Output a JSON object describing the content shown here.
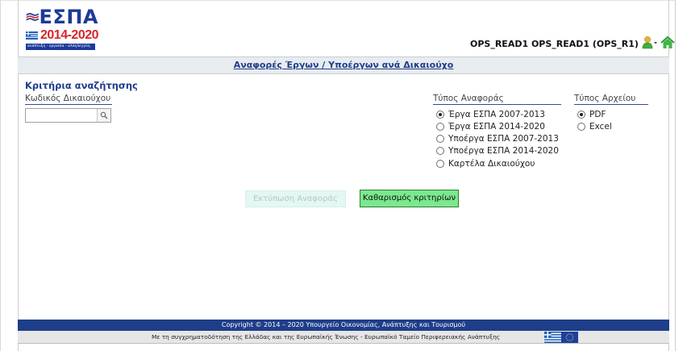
{
  "logo": {
    "brand": "ΕΣΠΑ",
    "years": "2014-2020",
    "slogan": "ανάπτυξη - εργασία - αλληλεγγύη"
  },
  "header": {
    "user": "OPS_READ1 OPS_READ1 (OPS_R1)",
    "user_icon": "user-dropdown-icon",
    "home_icon": "home-icon"
  },
  "title": "Αναφορές Έργων / Υποέργων ανά Δικαιούχο",
  "criteria": {
    "heading": "Κριτήρια αναζήτησης",
    "code_label": "Κωδικός Δικαιούχου",
    "code_value": "",
    "code_placeholder": "",
    "report_type_label": "Τύπος Αναφοράς",
    "report_types": [
      {
        "label": "Έργα ΕΣΠΑ 2007-2013",
        "checked": true
      },
      {
        "label": "Έργα ΕΣΠΑ 2014-2020",
        "checked": false
      },
      {
        "label": "Υποέργα ΕΣΠΑ 2007-2013",
        "checked": false
      },
      {
        "label": "Υποέργα ΕΣΠΑ 2014-2020",
        "checked": false
      },
      {
        "label": "Καρτέλα Δικαιούχου",
        "checked": false
      }
    ],
    "file_type_label": "Τύπος Αρχείου",
    "file_types": [
      {
        "label": "PDF",
        "checked": true
      },
      {
        "label": "Excel",
        "checked": false
      }
    ]
  },
  "buttons": {
    "print": "Εκτύπωση Αναφοράς",
    "clear": "Καθαρισμός κριτηρίων"
  },
  "footer": {
    "copyright": "Copyright © 2014 – 2020 Υπουργείο Οικονομίας, Ανάπτυξης και Τουρισμού",
    "funding": "Με τη συγχρηματοδότηση της Ελλάδας και της Ευρωπαϊκής Ένωσης - Ευρωπαϊκό Ταμείο Περιφερειακής Ανάπτυξης"
  },
  "colors": {
    "brand_blue": "#1f3e8a",
    "brand_red": "#d7262c",
    "clear_button": "#7be88e"
  }
}
